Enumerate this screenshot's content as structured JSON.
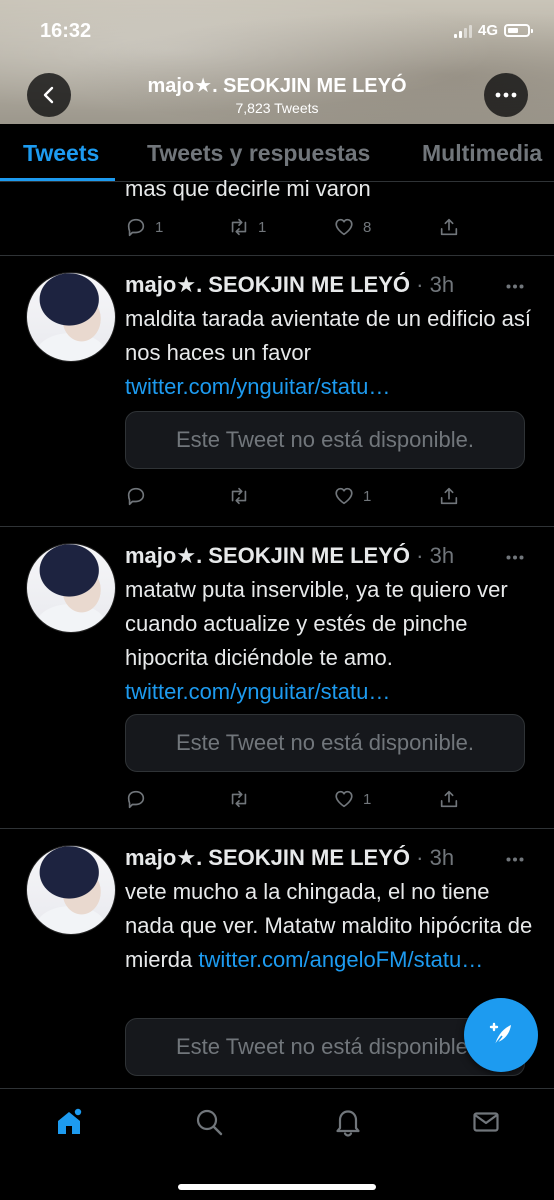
{
  "status_bar": {
    "time": "16:32",
    "network": "4G"
  },
  "header": {
    "title": "majo★. SEOKJIN ME LEYÓ",
    "tweet_count": "7,823 Tweets"
  },
  "tabs": [
    {
      "label": "Tweets",
      "active": true
    },
    {
      "label": "Tweets y respuestas",
      "active": false
    },
    {
      "label": "Multimedia",
      "active": false
    }
  ],
  "partial_tweet": {
    "text": "mas que decirle mi varon",
    "replies": "1",
    "retweets": "1",
    "likes": "8"
  },
  "tweets": [
    {
      "author": "majo★. SEOKJIN ME LEYÓ",
      "time": "3h",
      "text": "maldita tarada avientate de un edificio así nos haces un favor",
      "link": "twitter.com/ynguitar/statu…",
      "embed": "Este Tweet no está disponible.",
      "likes": "1"
    },
    {
      "author": "majo★. SEOKJIN ME LEYÓ",
      "time": "3h",
      "text": "matatw puta inservible, ya te quiero ver cuando actualize y estés de pinche hipocrita diciéndole te amo.",
      "link": "twitter.com/ynguitar/statu…",
      "embed": "Este Tweet no está disponible.",
      "likes": "1"
    },
    {
      "author": "majo★. SEOKJIN ME LEYÓ",
      "time": "3h",
      "text": "vete mucho a la chingada, el no tiene nada que ver. Matatw maldito hipócrita de mierda",
      "link": "twitter.com/angeloFM/statu…",
      "embed": "Este Tweet no está disponible."
    }
  ],
  "colors": {
    "accent": "#1d9bf0",
    "background": "#000000",
    "muted": "#71767b"
  },
  "icons": [
    "back-arrow-icon",
    "more-icon",
    "reply-icon",
    "retweet-icon",
    "like-icon",
    "share-icon",
    "compose-icon",
    "home-icon",
    "search-icon",
    "notifications-icon",
    "messages-icon"
  ]
}
